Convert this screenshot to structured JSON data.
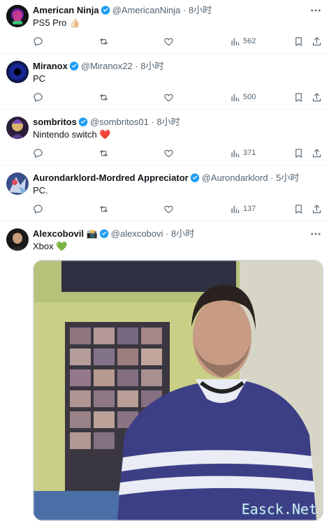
{
  "tweets": [
    {
      "name": "American Ninja",
      "handle": "@AmericanNinja",
      "time": "8小时",
      "text": "PS5 Pro",
      "emoji": "👍🏻",
      "views": "562"
    },
    {
      "name": "Miranox",
      "handle": "@Miranox22",
      "time": "8小时",
      "text": "PC",
      "emoji": "",
      "views": "500"
    },
    {
      "name": "sombritos",
      "handle": "@sombritos01",
      "time": "8小时",
      "text": "Nintendo switch",
      "emoji": "❤️",
      "views": "371"
    },
    {
      "name": "Aurondarklord-Mordred Appreciator",
      "handle": "@Aurondarklord",
      "time": "5小时",
      "text": "PC.",
      "emoji": "",
      "views": "137"
    },
    {
      "name": "Alexcobovil",
      "name_emoji": "📸",
      "handle": "@alexcobovi",
      "time": "8小时",
      "text": "Xbox",
      "emoji": "💚",
      "media_watermark": "Easck.Net"
    }
  ],
  "colors": {
    "verified": "#1d9bf0",
    "muted": "#536471",
    "divider": "#eff3f4",
    "heart": "#e0245e",
    "green_heart": "#6fbf3a"
  },
  "icons": [
    "reply-icon",
    "retweet-icon",
    "like-icon",
    "views-icon",
    "bookmark-icon",
    "share-icon",
    "more-icon",
    "verified-badge-icon"
  ]
}
